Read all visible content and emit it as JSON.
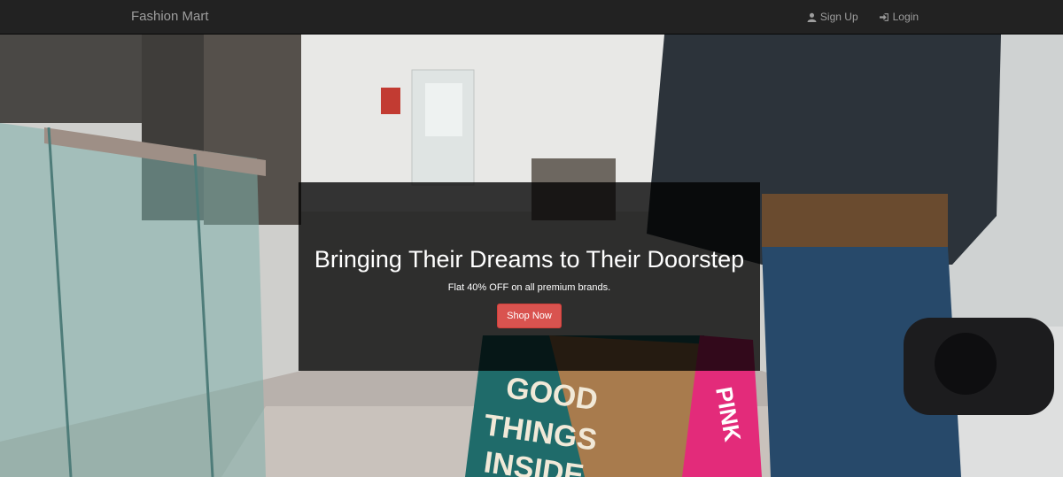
{
  "navbar": {
    "brand": "Fashion Mart",
    "links": [
      {
        "label": "Sign Up",
        "icon": "user-icon"
      },
      {
        "label": "Login",
        "icon": "login-icon"
      }
    ]
  },
  "hero": {
    "title": "Bringing Their Dreams to Their Doorstep",
    "subtitle": "Flat 40% OFF on all premium brands.",
    "cta_label": "Shop Now",
    "bag_left_text": [
      "GOOD",
      "THINGS",
      "INSIDE"
    ],
    "bag_right_text": "PINK"
  },
  "colors": {
    "navbar_bg": "#222222",
    "navbar_text": "#9d9d9d",
    "cta_bg": "#d9534f"
  }
}
